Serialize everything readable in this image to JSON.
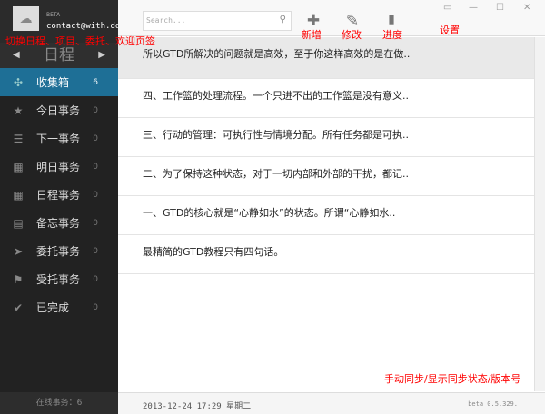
{
  "sidebar": {
    "beta": "BETA",
    "email": "contact@with.do",
    "nav_title": "日程",
    "items": [
      {
        "label": "收集箱",
        "count": "6",
        "icon": "puzzle-icon"
      },
      {
        "label": "今日事务",
        "count": "0",
        "icon": "star-icon"
      },
      {
        "label": "下一事务",
        "count": "0",
        "icon": "list-icon"
      },
      {
        "label": "明日事务",
        "count": "0",
        "icon": "calendar-icon"
      },
      {
        "label": "日程事务",
        "count": "0",
        "icon": "calendar-grid-icon"
      },
      {
        "label": "备忘事务",
        "count": "0",
        "icon": "clipboard-icon"
      },
      {
        "label": "委托事务",
        "count": "0",
        "icon": "send-icon"
      },
      {
        "label": "受托事务",
        "count": "0",
        "icon": "flag-icon"
      },
      {
        "label": "已完成",
        "count": "0",
        "icon": "check-icon"
      }
    ],
    "footer": "在线事务：6"
  },
  "header": {
    "search_placeholder": "Search..."
  },
  "list": [
    "所以GTD所解决的问题就是高效，至于你这样高效的是在做..",
    "四、工作篮的处理流程。一个只进不出的工作篮是没有意义..",
    "三、行动的管理：可执行性与情境分配。所有任务都是可执..",
    "二、为了保持这种状态，对于一切内部和外部的干扰，都记..",
    "一、GTD的核心就是“心静如水”的状态。所谓“心静如水..",
    "最精简的GTD教程只有四句话。"
  ],
  "footer": {
    "datetime": "2013-12-24 17:29 星期二",
    "version": "beta 0.5.329."
  },
  "annotations": {
    "switch": "切换日程、项目、委托、欢迎页签",
    "add": "新增",
    "edit": "修改",
    "progress": "进度",
    "settings": "设置",
    "sync": "手动同步/显示同步状态/版本号"
  },
  "colors": {
    "active": "#1e6f96",
    "annotation": "#ff0000"
  }
}
